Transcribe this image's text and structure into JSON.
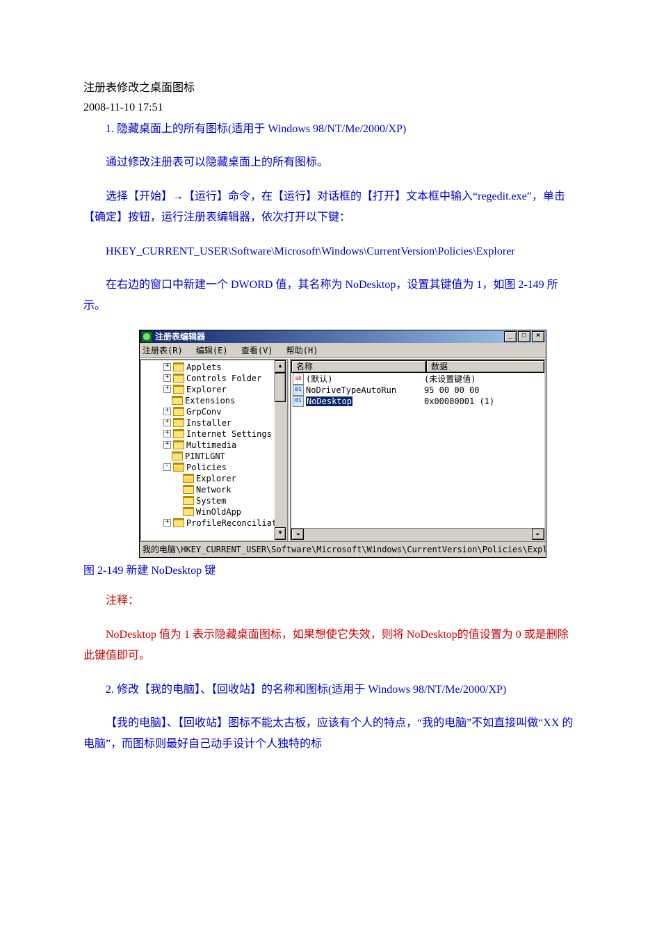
{
  "doc": {
    "title": "注册表修改之桌面图标",
    "timestamp": "2008-11-10 17:51",
    "p1": "1. 隐藏桌面上的所有图标(适用于 Windows 98/NT/Me/2000/XP)",
    "p2": "通过修改注册表可以隐藏桌面上的所有图标。",
    "p3": "选择【开始】→【运行】命令，在【运行】对话框的【打开】文本框中输入“regedit.exe”，单击【确定】按钮，运行注册表编辑器，依次打开以下键：",
    "p4": "HKEY_CURRENT_USER\\Software\\Microsoft\\Windows\\CurrentVersion\\Policies\\Explorer",
    "p5": "在右边的窗口中新建一个 DWORD 值，其名称为 NoDesktop，设置其键值为 1，如图 2-149 所示。",
    "caption": "图 2-149  新建 NoDesktop 键",
    "note_hdr": "注释：",
    "note_body": "NoDesktop 值为 1 表示隐藏桌面图标，如果想使它失效，则将 NoDesktop的值设置为 0 或是删除此键值即可。",
    "p6": "2. 修改【我的电脑】、【回收站】的名称和图标(适用于 Windows 98/NT/Me/2000/XP)",
    "p7": "【我的电脑】、【回收站】图标不能太古板，应该有个人的特点，“我的电脑”不如直接叫做“XX 的电脑”，而图标则最好自己动手设计个人独特的标"
  },
  "win": {
    "title": "注册表编辑器",
    "menu": {
      "reg": "注册表(R)",
      "edit": "编辑(E)",
      "view": "查看(V)",
      "help": "帮助(H)"
    },
    "btn": {
      "min": "_",
      "max": "□",
      "close": "×"
    },
    "tree": [
      {
        "ind": 1,
        "exp": "+",
        "label": "Applets"
      },
      {
        "ind": 1,
        "exp": "+",
        "label": "Controls Folder"
      },
      {
        "ind": 1,
        "exp": "+",
        "label": "Explorer"
      },
      {
        "ind": 1,
        "exp": " ",
        "label": "Extensions"
      },
      {
        "ind": 1,
        "exp": "+",
        "label": "GrpConv"
      },
      {
        "ind": 1,
        "exp": "+",
        "label": "Installer"
      },
      {
        "ind": 1,
        "exp": "+",
        "label": "Internet Settings"
      },
      {
        "ind": 1,
        "exp": "+",
        "label": "Multimedia"
      },
      {
        "ind": 1,
        "exp": " ",
        "label": "PINTLGNT"
      },
      {
        "ind": 1,
        "exp": "-",
        "label": "Policies",
        "open": true
      },
      {
        "ind": 2,
        "exp": " ",
        "label": "Explorer",
        "open": true
      },
      {
        "ind": 2,
        "exp": " ",
        "label": "Network"
      },
      {
        "ind": 2,
        "exp": " ",
        "label": "System"
      },
      {
        "ind": 2,
        "exp": " ",
        "label": "WinOldApp"
      },
      {
        "ind": 1,
        "exp": "+",
        "label": "ProfileReconciliat"
      }
    ],
    "cols": {
      "name": "名称",
      "data": "数据"
    },
    "rows": [
      {
        "icon": "ab",
        "name": "(默认)",
        "data": "(未设置键值)",
        "sel": false
      },
      {
        "icon": "bin",
        "name": "NoDriveTypeAutoRun",
        "data": "95 00 00 00",
        "sel": false
      },
      {
        "icon": "bin",
        "name": "NoDesktop",
        "data": "0x00000001 (1)",
        "sel": true
      }
    ],
    "scroll": {
      "up": "▲",
      "down": "▼",
      "left": "◄",
      "right": "►"
    },
    "status": "我的电脑\\HKEY_CURRENT_USER\\Software\\Microsoft\\Windows\\CurrentVersion\\Policies\\Explorer"
  }
}
